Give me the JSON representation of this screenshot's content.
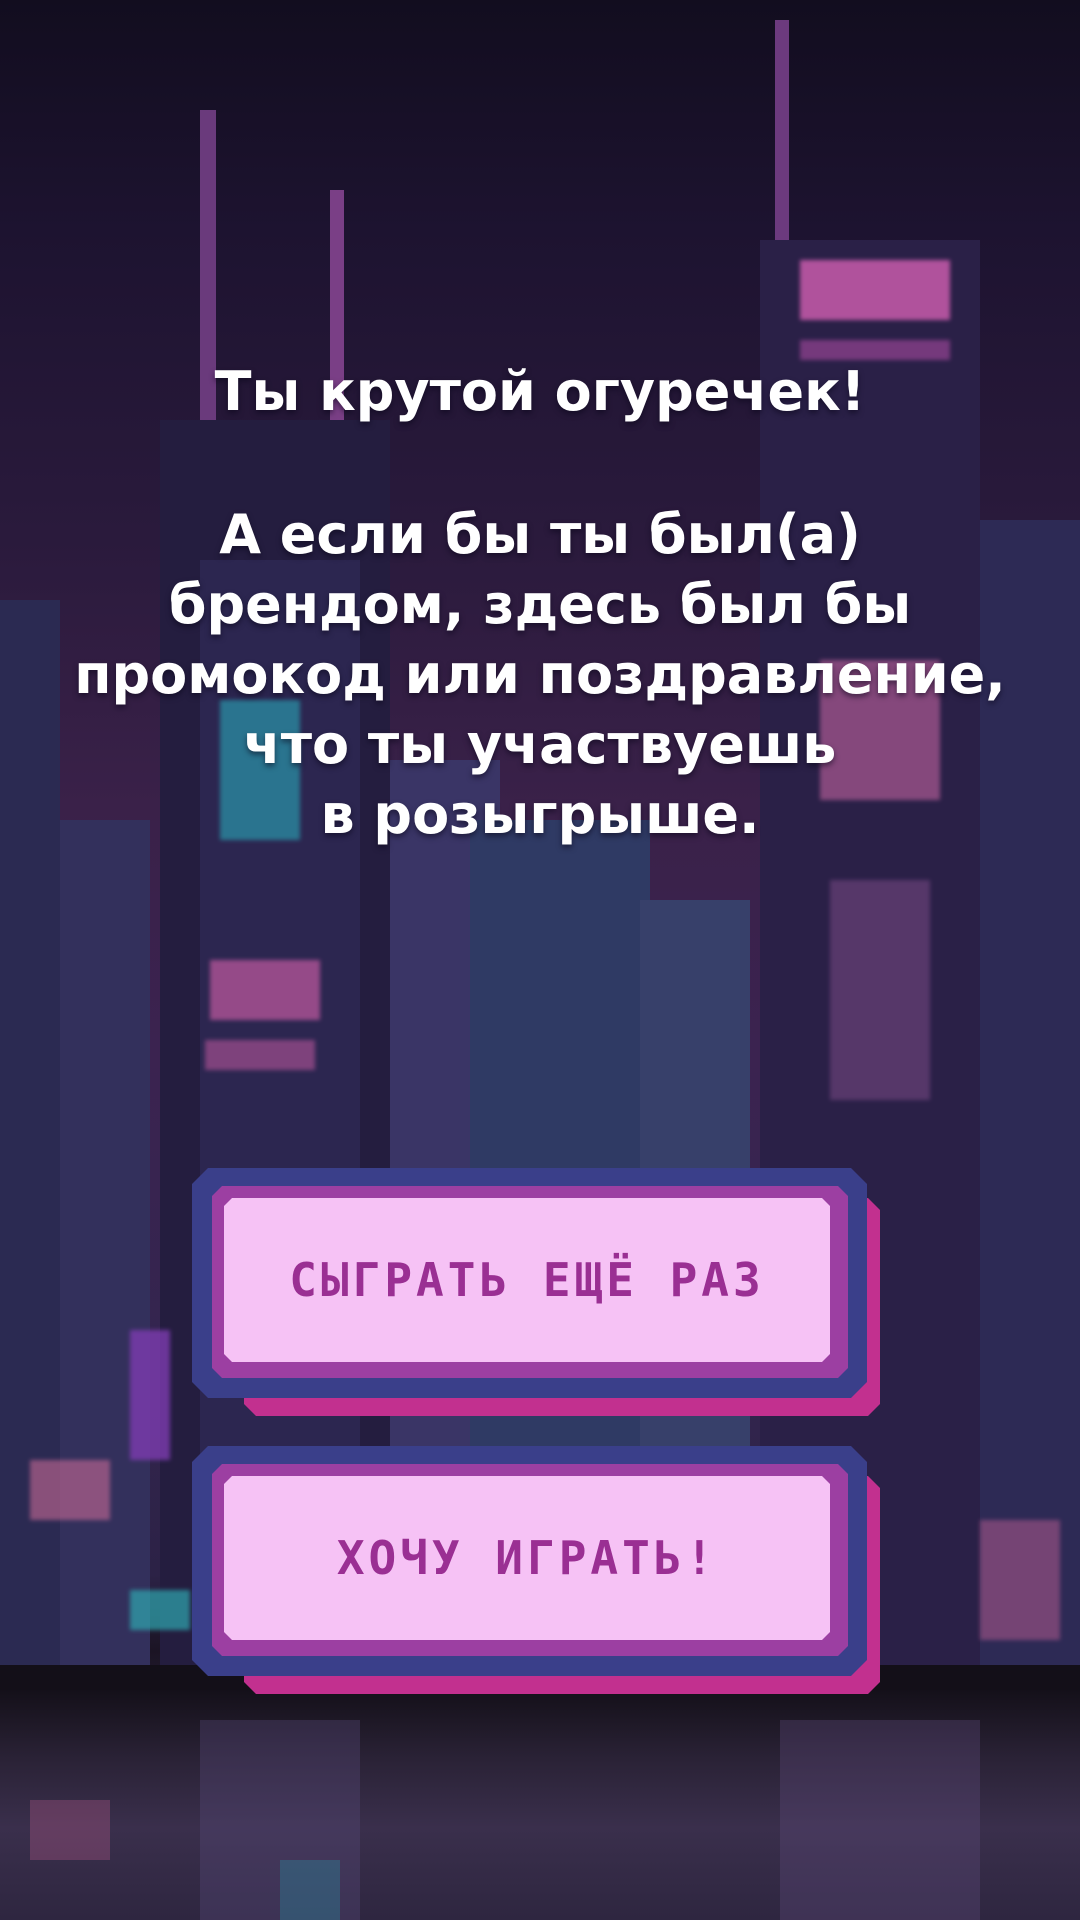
{
  "headline": "Ты крутой огуречек!",
  "message": "А если бы ты был(а)\nбрендом, здесь был бы\nпромокод или поздравление,\nчто ты участвуешь\nв розыгрыше.",
  "buttons": {
    "play_again": "СЫГРАТЬ ЕЩЁ РАЗ",
    "want_play": "ХОЧУ ИГРАТЬ!"
  },
  "colors": {
    "button_face": "#f6c2f5",
    "button_text": "#9a2f93",
    "button_border": "#3a3f8a",
    "button_shadow": "#c2308f",
    "background": "#2a1a3c"
  }
}
